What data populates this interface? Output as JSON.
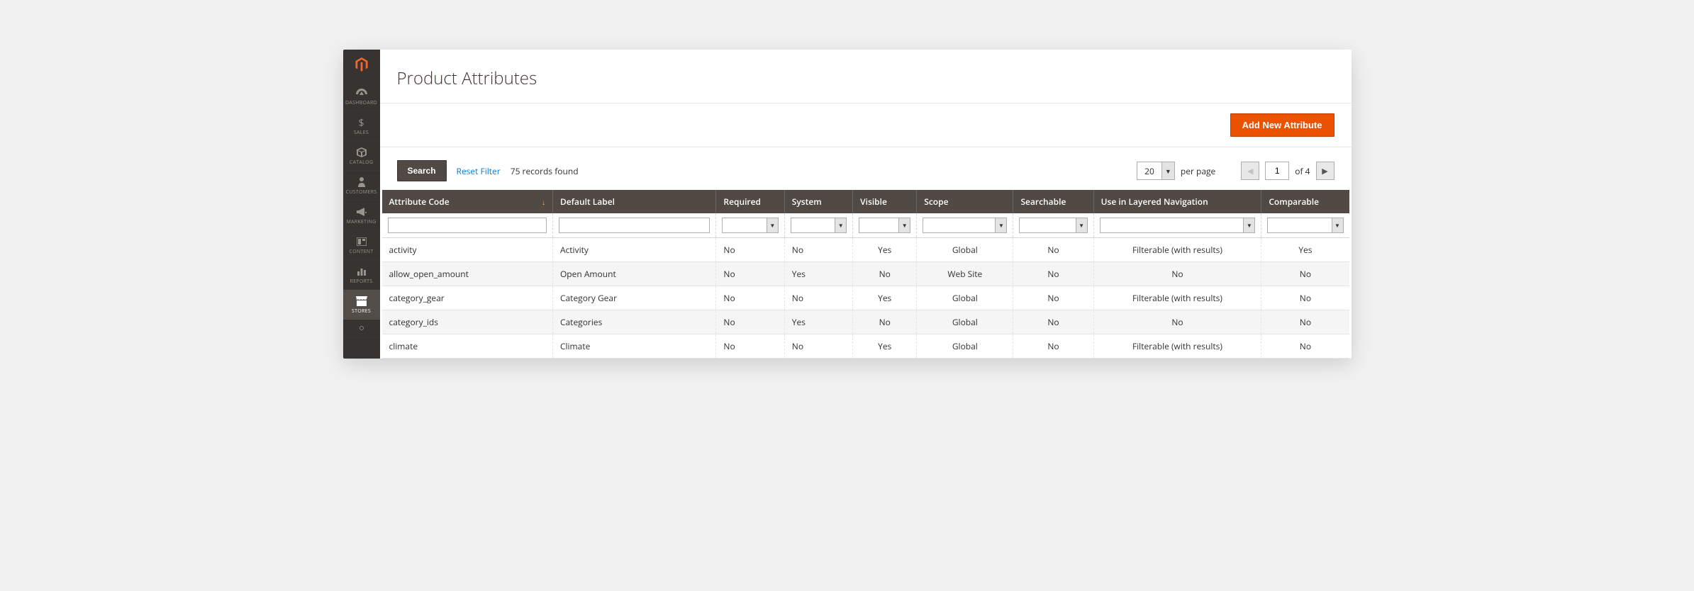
{
  "sidebar": {
    "items": [
      {
        "label": "DASHBOARD",
        "icon": "gauge"
      },
      {
        "label": "SALES",
        "icon": "dollar"
      },
      {
        "label": "CATALOG",
        "icon": "cube"
      },
      {
        "label": "CUSTOMERS",
        "icon": "person"
      },
      {
        "label": "MARKETING",
        "icon": "megaphone"
      },
      {
        "label": "CONTENT",
        "icon": "layout"
      },
      {
        "label": "REPORTS",
        "icon": "bars"
      },
      {
        "label": "STORES",
        "icon": "storefront",
        "active": true
      }
    ]
  },
  "page_title": "Product Attributes",
  "actions": {
    "add_new": "Add New Attribute"
  },
  "toolbar": {
    "search_label": "Search",
    "reset_label": "Reset Filter",
    "records_found": "75 records found",
    "per_page_value": "20",
    "per_page_label": "per page",
    "page_value": "1",
    "of_pages": "of 4"
  },
  "columns": {
    "code": "Attribute Code",
    "label": "Default Label",
    "required": "Required",
    "system": "System",
    "visible": "Visible",
    "scope": "Scope",
    "searchable": "Searchable",
    "layered": "Use in Layered Navigation",
    "comparable": "Comparable"
  },
  "rows": [
    {
      "code": "activity",
      "label": "Activity",
      "required": "No",
      "system": "No",
      "visible": "Yes",
      "scope": "Global",
      "searchable": "No",
      "layered": "Filterable (with results)",
      "comparable": "Yes"
    },
    {
      "code": "allow_open_amount",
      "label": "Open Amount",
      "required": "No",
      "system": "Yes",
      "visible": "No",
      "scope": "Web Site",
      "searchable": "No",
      "layered": "No",
      "comparable": "No"
    },
    {
      "code": "category_gear",
      "label": "Category Gear",
      "required": "No",
      "system": "No",
      "visible": "Yes",
      "scope": "Global",
      "searchable": "No",
      "layered": "Filterable (with results)",
      "comparable": "No"
    },
    {
      "code": "category_ids",
      "label": "Categories",
      "required": "No",
      "system": "Yes",
      "visible": "No",
      "scope": "Global",
      "searchable": "No",
      "layered": "No",
      "comparable": "No"
    },
    {
      "code": "climate",
      "label": "Climate",
      "required": "No",
      "system": "No",
      "visible": "Yes",
      "scope": "Global",
      "searchable": "No",
      "layered": "Filterable (with results)",
      "comparable": "No"
    }
  ]
}
